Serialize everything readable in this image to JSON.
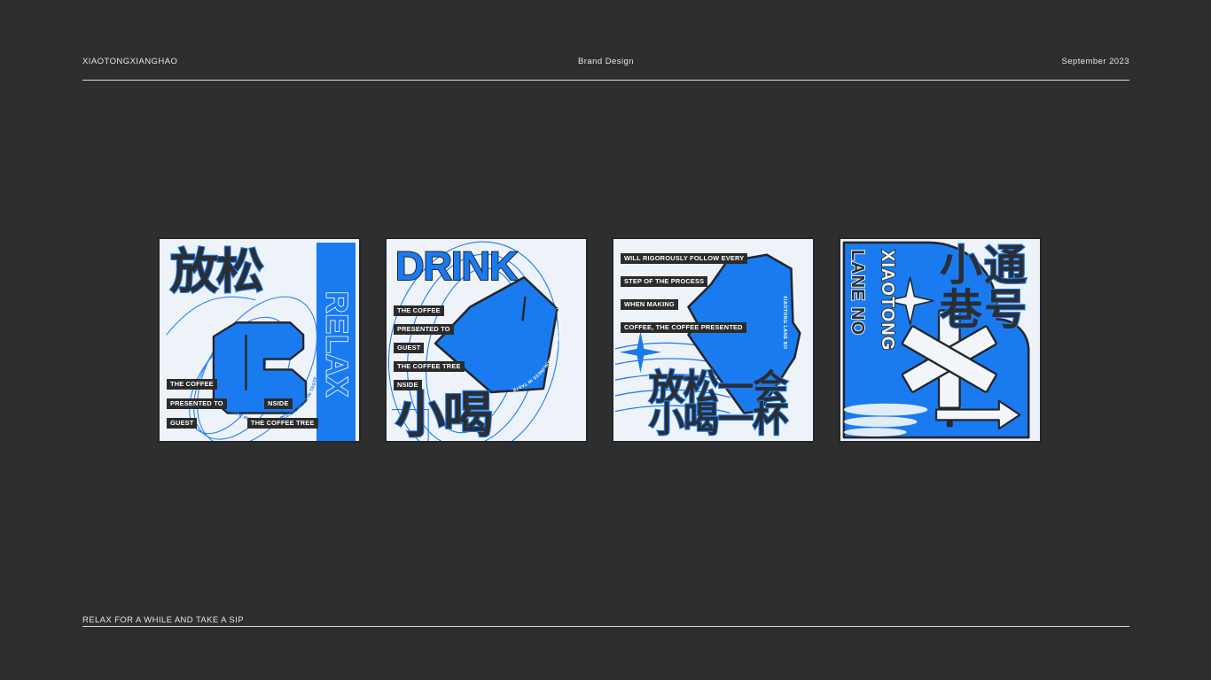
{
  "theme": {
    "background": "#2e2e2e",
    "poster_bg": "#eef3f9",
    "accent_blue": "#1a7bf0",
    "ink": "#2b2e33",
    "rule": "#d8d8d8"
  },
  "header": {
    "left": "XIAOTONGXIANGHAO",
    "center": "Brand Design",
    "right": "September 2023"
  },
  "footer": {
    "caption": "RELAX FOR A WHILE AND TAKE A SIP"
  },
  "posters": [
    {
      "id": "poster-relax",
      "headline_cjk": "放松",
      "vertical_word": "RELAX",
      "curved_text": "ACIDITY, RICHNESS, OR CLEANLINESS IN TASTE.",
      "chips": [
        "THE COFFEE",
        "PRESENTED TO",
        "GUEST",
        "NSIDE",
        "THE COFFEE TREE"
      ]
    },
    {
      "id": "poster-drink",
      "headline_latin": "DRINK",
      "headline_cjk": "小喝",
      "curved_text": "ACIDITY, RICHNESS, OR CLEANLINESS IN TASTE.",
      "chips": [
        "THE COFFEE",
        "PRESENTED TO",
        "GUEST",
        "THE COFFEE TREE",
        "NSIDE"
      ]
    },
    {
      "id": "poster-process",
      "chips": [
        "WILL RIGOROUSLY FOLLOW EVERY",
        "STEP OF THE PROCESS",
        "WHEN MAKING",
        "COFFEE, THE COFFEE PRESENTED"
      ],
      "vertical_word": "XIAOTONG LANE NO",
      "headline_cjk_line1": "放松一会",
      "headline_cjk_line2": "小喝一杯"
    },
    {
      "id": "poster-lane",
      "vertical_word_1": "XIAOTONG",
      "vertical_word_2": "LANE NO",
      "headline_cjk_line1": "小通",
      "headline_cjk_line2": "巷号"
    }
  ]
}
